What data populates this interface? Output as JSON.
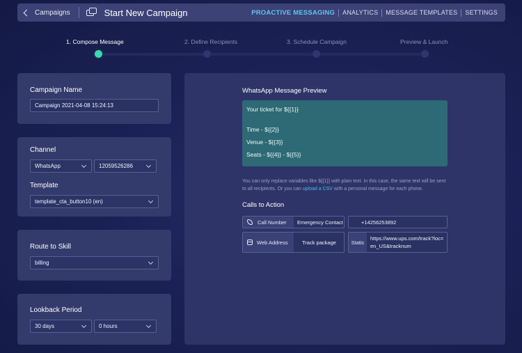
{
  "header": {
    "back_label": "Campaigns",
    "title": "Start New Campaign",
    "nav": [
      "PROACTIVE MESSAGING",
      "ANALYTICS",
      "MESSAGE TEMPLATES",
      "SETTINGS"
    ]
  },
  "steps": [
    "1. Compose Message",
    "2. Define Recipients",
    "3. Schedule Campaign",
    "Preview & Launch"
  ],
  "campaign": {
    "label": "Campaign Name",
    "value": "Campaign 2021-04-08 15:24:13"
  },
  "channel": {
    "label": "Channel",
    "channel_value": "WhatsApp",
    "number_value": "12059526286",
    "template_label": "Template",
    "template_value": "template_cta_button10 (en)"
  },
  "skill": {
    "label": "Route to Skill",
    "value": "billing"
  },
  "lookback": {
    "label": "Lookback Period",
    "days_value": "30 days",
    "hours_value": "0 hours"
  },
  "preview": {
    "title": "WhatsApp Message Preview",
    "line1": "Your ticket for   ${{1}}",
    "line2": "Time -   ${{2}}",
    "line3": "Venue -   ${{3}}",
    "line4": "Seats -   ${{4}}  -   ${{5}}",
    "note_part1": "You can only replace variables like ${{1}} with plain text. In this case, the same text will be sent to all recipients. Or you can ",
    "note_link": "upload a CSV",
    "note_part2": " with a personal message for each phone."
  },
  "cta": {
    "title": "Calls to Action",
    "call_type": "Call Number",
    "call_text": "Emergency Contact",
    "call_value": "+14256253892",
    "web_type": "Web Address",
    "web_text": "Track package",
    "web_mode": "Static",
    "web_value": "https://www.ups.com/track?loc=en_US&tracknum"
  },
  "colors": {
    "accent": "#5cc6f2",
    "active_step": "#3ed6b0",
    "bubble": "#2d6a75",
    "link": "#4fb8f0"
  }
}
